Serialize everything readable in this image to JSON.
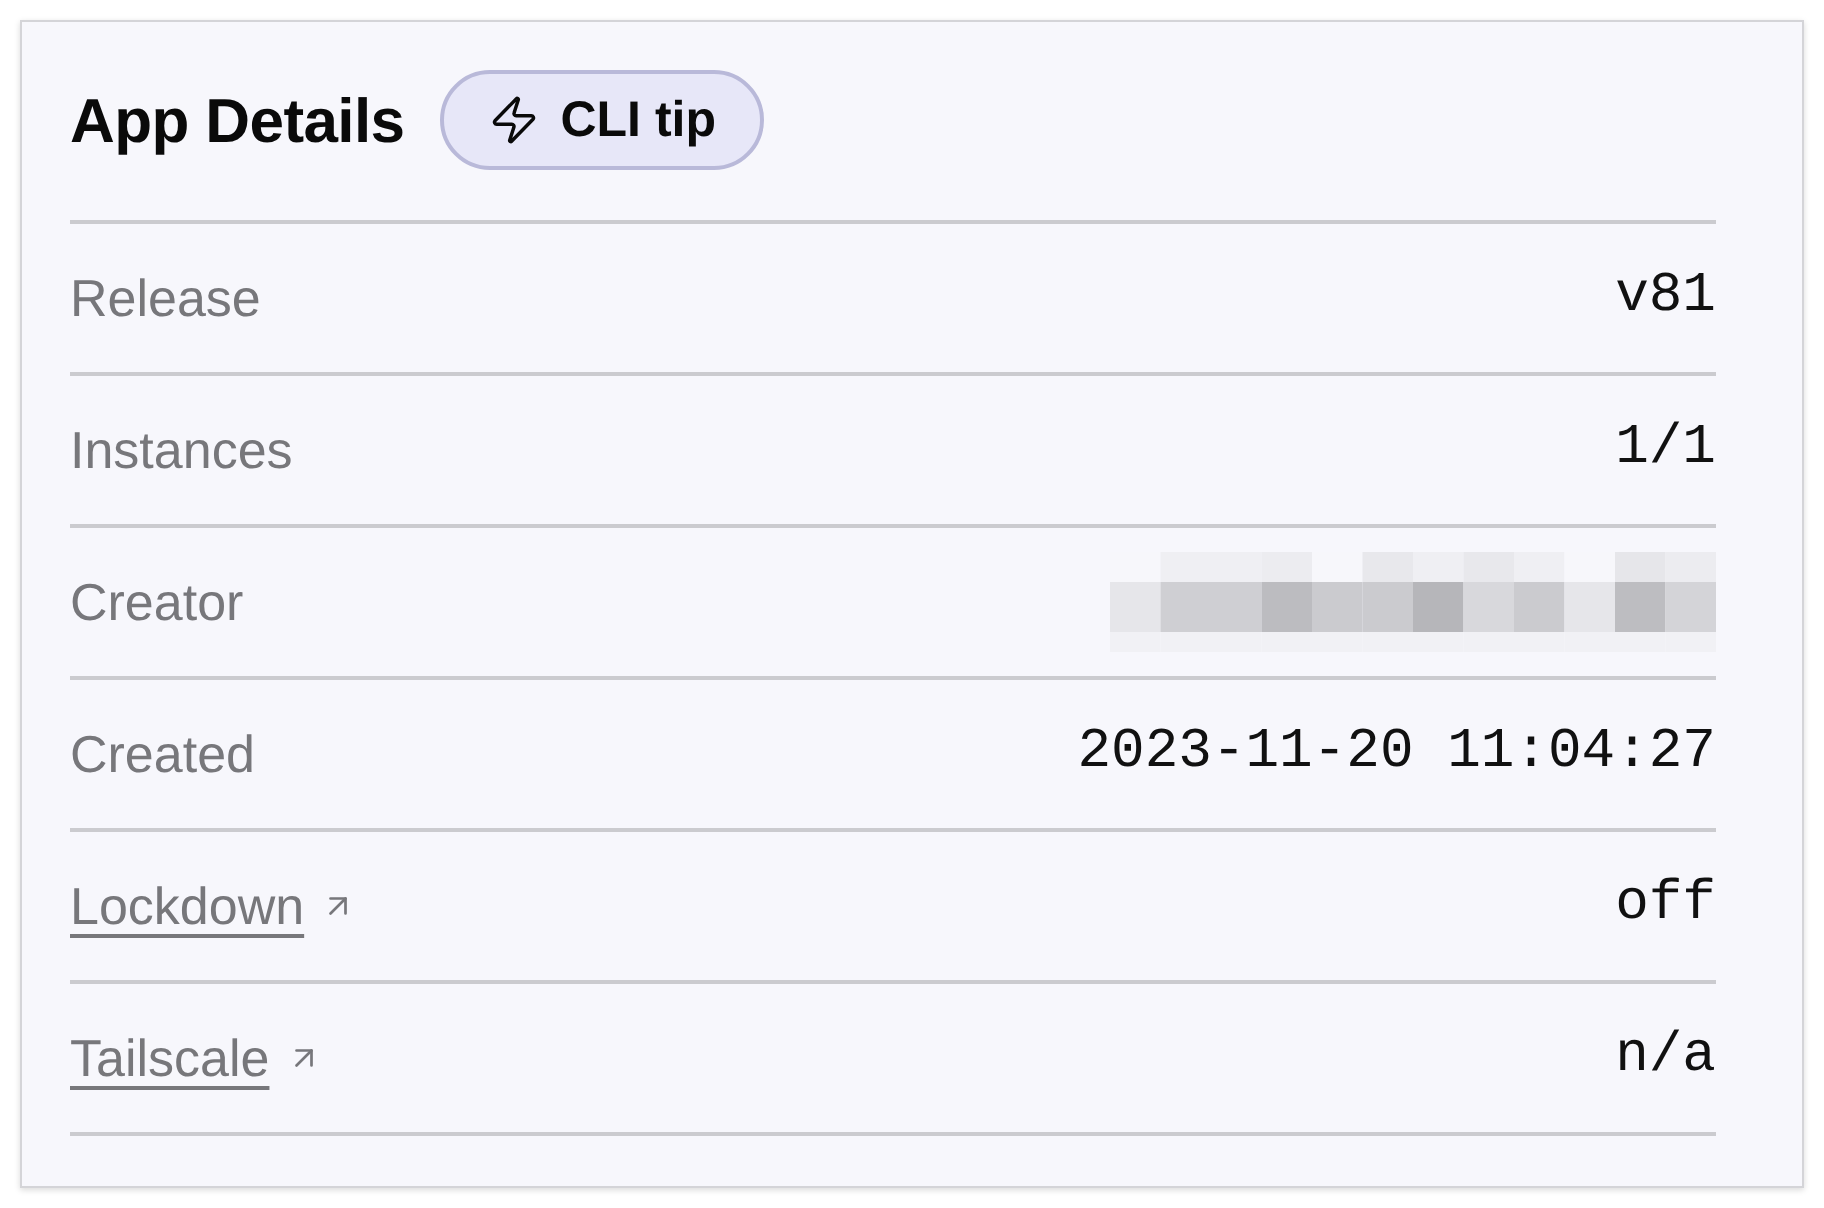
{
  "card": {
    "title": "App Details",
    "tip_button": {
      "label": "CLI tip"
    }
  },
  "rows": [
    {
      "label": "Release",
      "link": false,
      "kind": "text",
      "value": "v81"
    },
    {
      "label": "Instances",
      "link": false,
      "kind": "text",
      "value": "1/1"
    },
    {
      "label": "Creator",
      "link": false,
      "kind": "redacted"
    },
    {
      "label": "Created",
      "link": false,
      "kind": "text",
      "value": "2023-11-20 11:04:27"
    },
    {
      "label": "Lockdown",
      "link": true,
      "kind": "text",
      "value": "off"
    },
    {
      "label": "Tailscale",
      "link": true,
      "kind": "text",
      "value": "n/a"
    }
  ]
}
